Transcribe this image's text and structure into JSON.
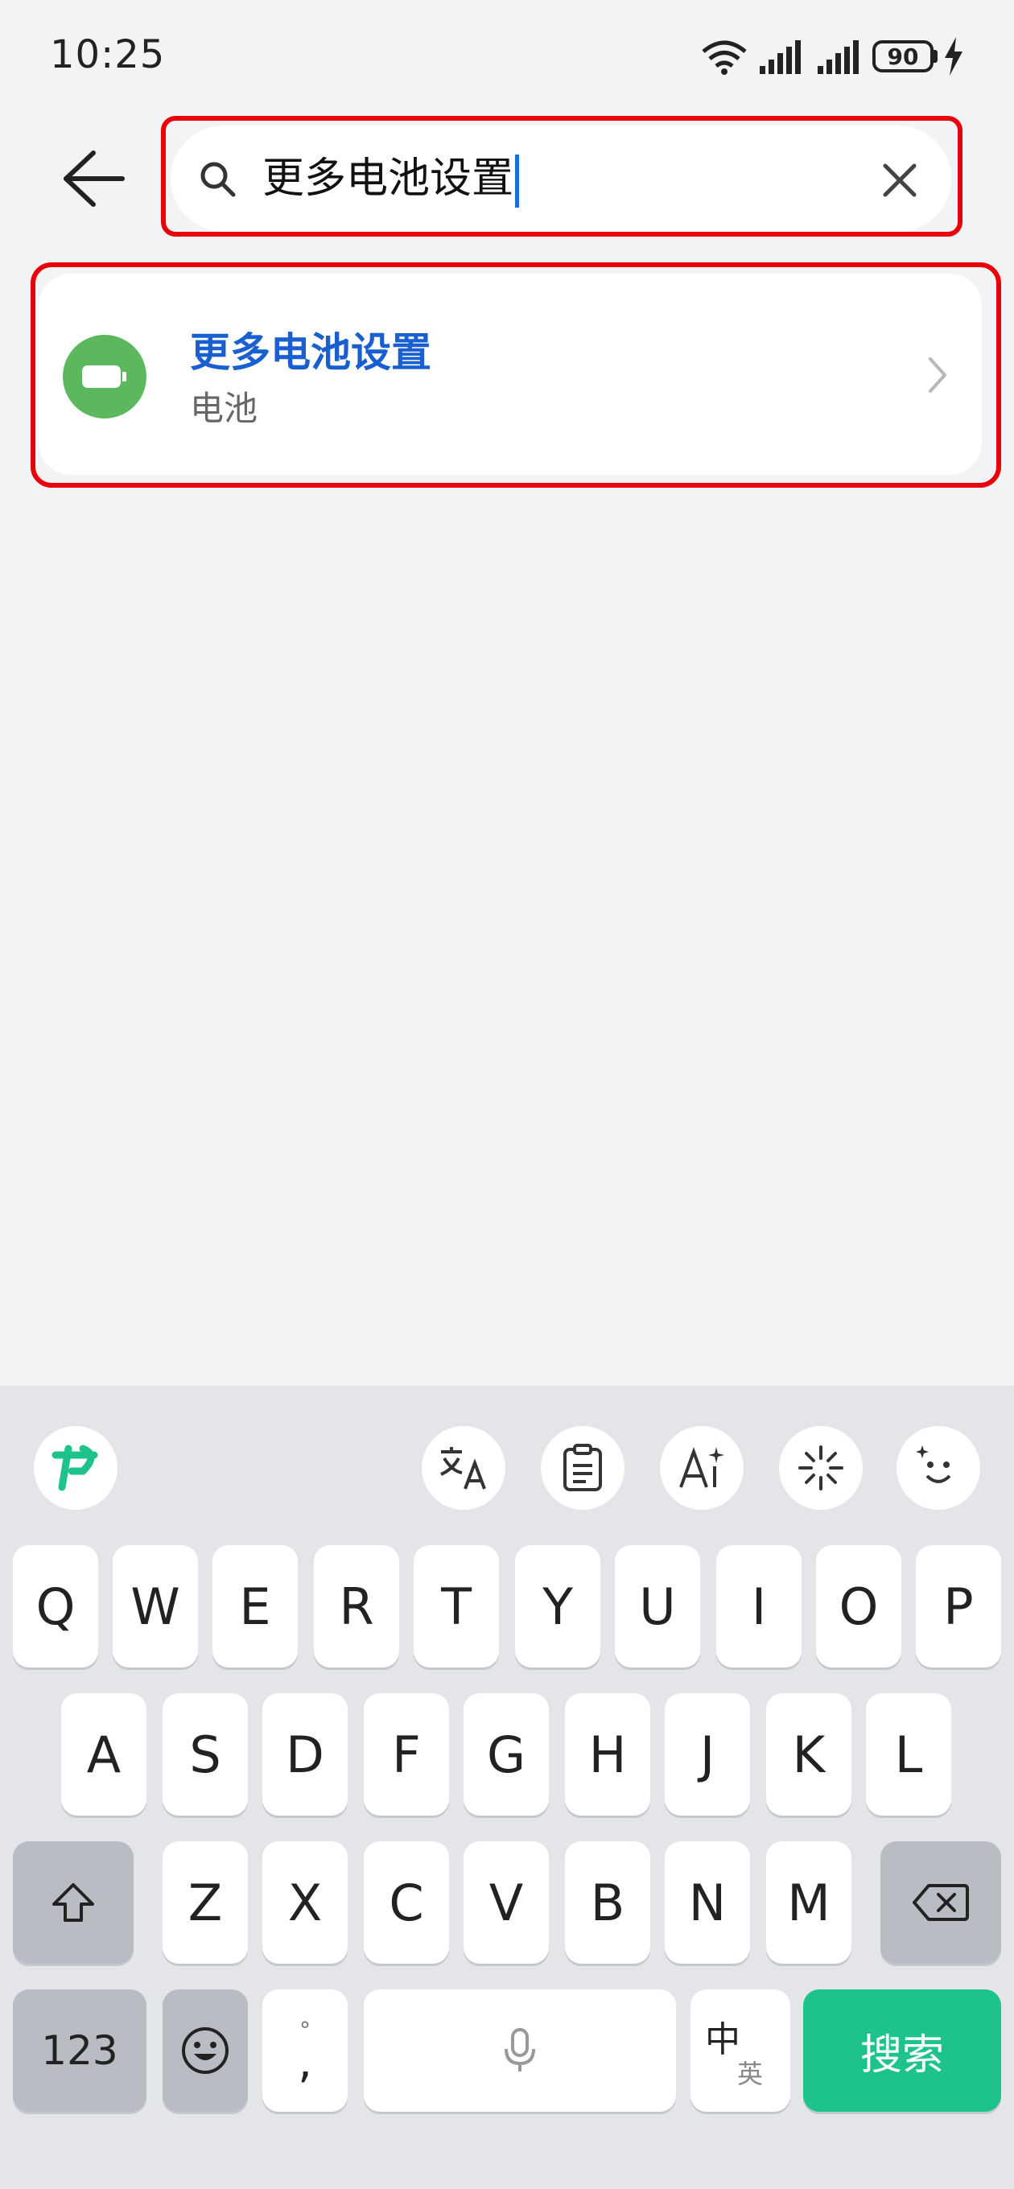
{
  "status_bar": {
    "time": "10:25",
    "battery": "90"
  },
  "search": {
    "query": "更多电池设置"
  },
  "result": {
    "title": "更多电池设置",
    "subtitle": "电池"
  },
  "keyboard": {
    "row1": [
      "Q",
      "W",
      "E",
      "R",
      "T",
      "Y",
      "U",
      "I",
      "O",
      "P"
    ],
    "row2": [
      "A",
      "S",
      "D",
      "F",
      "G",
      "H",
      "J",
      "K",
      "L"
    ],
    "row3": [
      "Z",
      "X",
      "C",
      "V",
      "B",
      "N",
      "M"
    ],
    "num_label": "123",
    "punct_top": "°",
    "punct_bottom": ",",
    "lang_main": "中",
    "lang_sub": "英",
    "search_label": "搜索"
  },
  "colors": {
    "highlight": "#e8000b",
    "accent_blue": "#1a5fd0",
    "battery_green": "#5cb85c",
    "search_key_green": "#1ec28b"
  }
}
